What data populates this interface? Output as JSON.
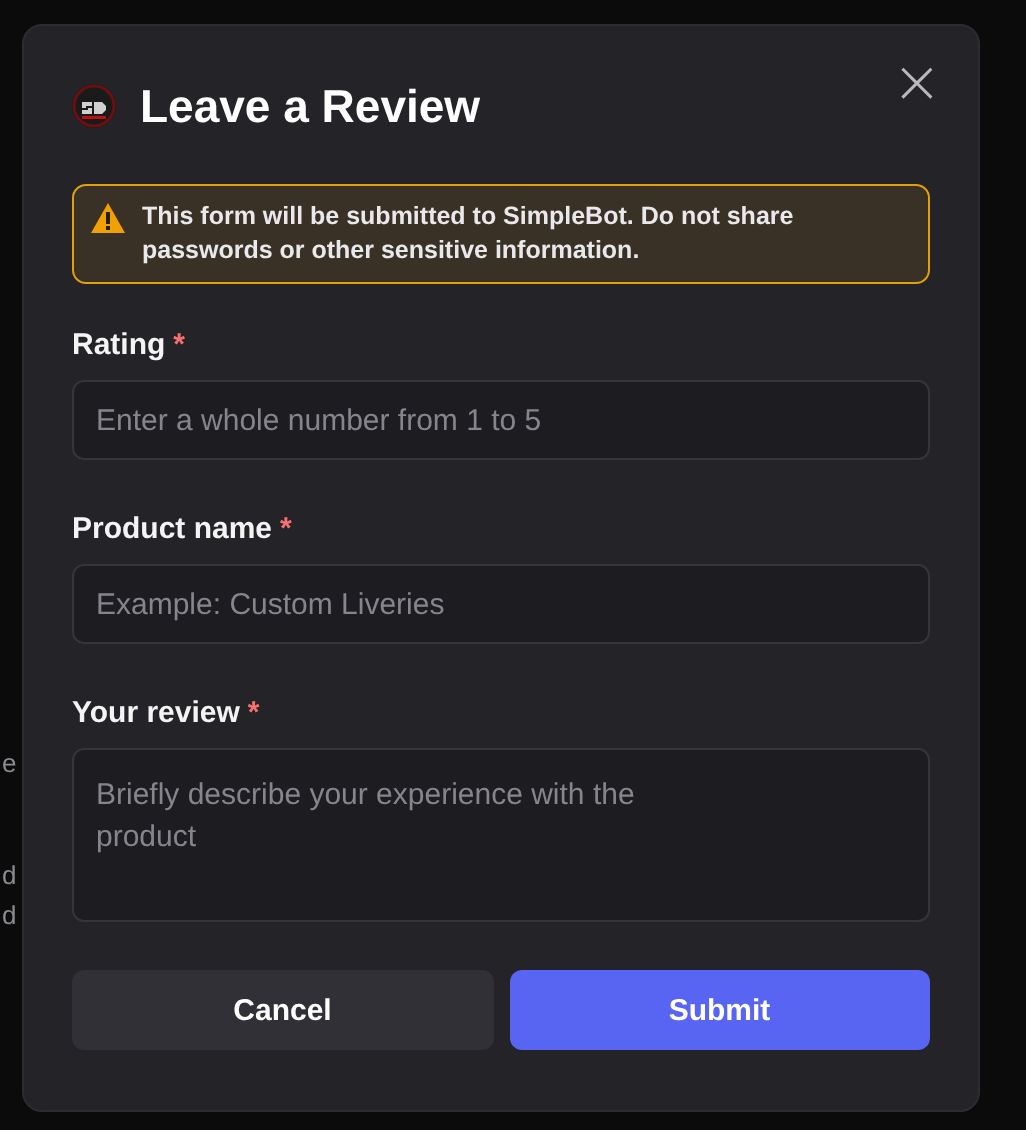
{
  "background_fragments": [
    "e",
    "d",
    "d"
  ],
  "dialog": {
    "title": "Leave a Review",
    "close": "×",
    "notice": "This form will be submitted to SimpleBot. Do not share passwords or other sensitive information.",
    "fields": [
      {
        "kind": "input",
        "label": "Rating",
        "marker": "*",
        "placeholder": "Enter a whole number from 1 to 5"
      },
      {
        "kind": "input",
        "label": "Product name",
        "marker": "*",
        "placeholder": "Example: Custom Liveries"
      },
      {
        "kind": "textarea",
        "label": "Your review",
        "marker": "*",
        "placeholder": "Briefly describe your experience with the product"
      }
    ],
    "buttons": [
      {
        "label": "Cancel",
        "kind": "secondary"
      },
      {
        "label": "Submit",
        "kind": "primary"
      }
    ]
  }
}
